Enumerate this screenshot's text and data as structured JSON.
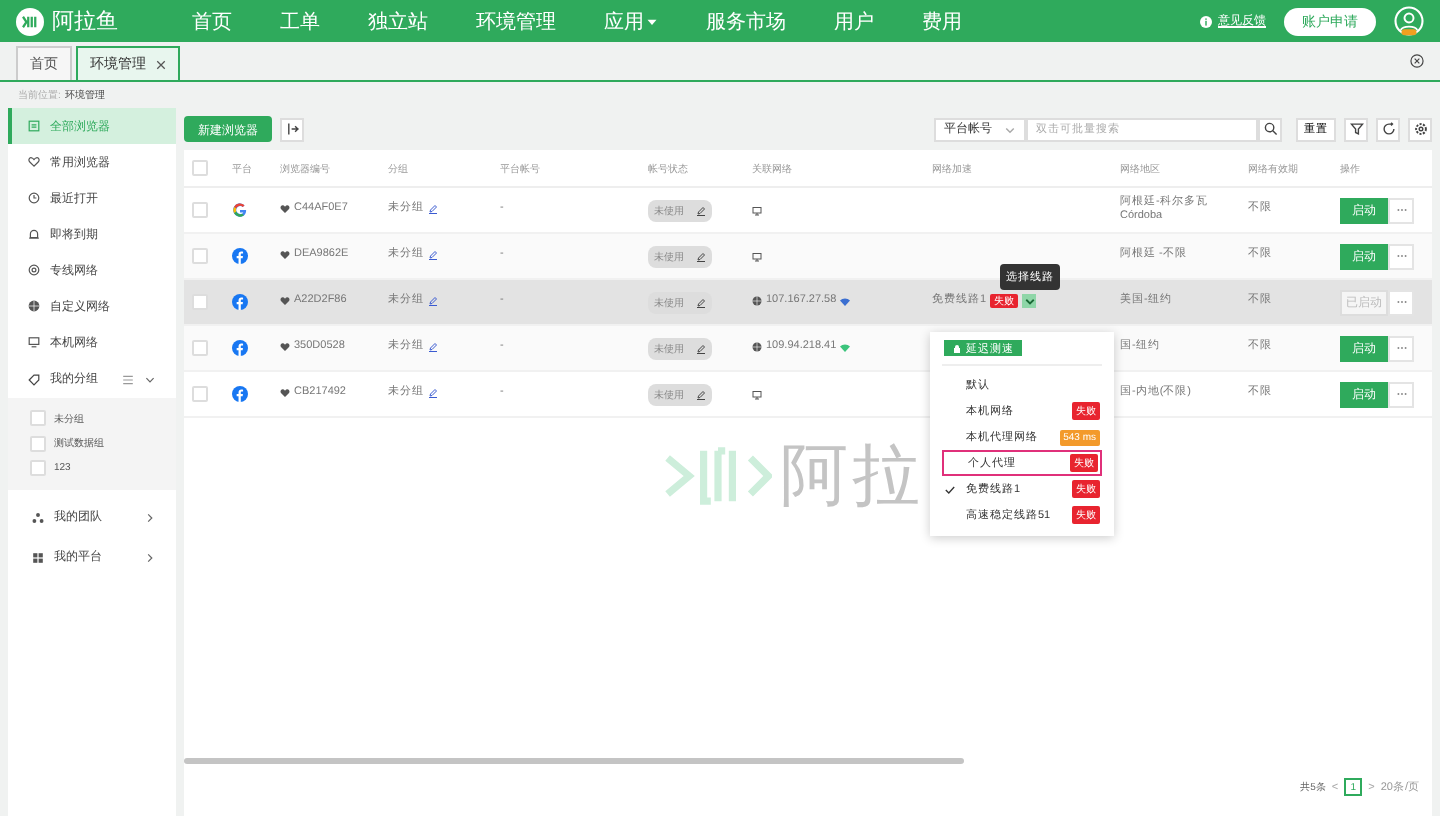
{
  "app": {
    "name": "阿拉鱼"
  },
  "nav": [
    {
      "label": "首页",
      "has_menu": false
    },
    {
      "label": "工单",
      "has_menu": false
    },
    {
      "label": "独立站",
      "has_menu": false
    },
    {
      "label": "环境管理",
      "has_menu": false
    },
    {
      "label": "应用",
      "has_menu": true
    },
    {
      "label": "服务市场",
      "has_menu": false
    },
    {
      "label": "用户",
      "has_menu": false
    },
    {
      "label": "费用",
      "has_menu": false
    }
  ],
  "header_right": {
    "feedback": "意见反馈",
    "account_button": "账户申请"
  },
  "tabs": [
    {
      "label": "首页",
      "selected": false,
      "closable": false
    },
    {
      "label": "环境管理",
      "selected": true,
      "closable": true
    }
  ],
  "breadcrumb": {
    "prefix": "当前位置:",
    "current": "环境管理"
  },
  "sidebar": {
    "items": [
      {
        "label": "全部浏览器",
        "kind": "list",
        "selected": true
      },
      {
        "label": "常用浏览器",
        "kind": "heart",
        "selected": false
      },
      {
        "label": "最近打开",
        "kind": "clock",
        "selected": false
      },
      {
        "label": "即将到期",
        "kind": "alarm",
        "selected": false
      },
      {
        "label": "专线网络",
        "kind": "target",
        "selected": false
      },
      {
        "label": "自定义网络",
        "kind": "globe",
        "selected": false
      },
      {
        "label": "本机网络",
        "kind": "monitor",
        "selected": false
      }
    ],
    "group_section": {
      "label": "我的分组",
      "expanded": true,
      "groups": [
        {
          "label": "未分组",
          "checked": false
        },
        {
          "label": "测试数据组",
          "checked": false
        },
        {
          "label": "123",
          "checked": false
        }
      ]
    },
    "bottom_items": [
      {
        "label": "我的团队",
        "kind": "team"
      },
      {
        "label": "我的平台",
        "kind": "grid"
      }
    ]
  },
  "toolbar": {
    "new_button": "新建浏览器",
    "search_scope": "平台帐号",
    "search": {
      "placeholder": "双击可批量搜索"
    },
    "reset_button": "重置"
  },
  "table": {
    "all_checked": false,
    "columns": [
      "平台",
      "浏览器编号",
      "分组",
      "平台帐号",
      "帐号状态",
      "关联网络",
      "网络加速",
      "网络地区",
      "网络有效期",
      "操作"
    ],
    "rows": [
      {
        "kind": "google",
        "checked": false,
        "id": "C44AF0E7",
        "group": "未分组",
        "account": "-",
        "status": "未使用",
        "network": {
          "kind": "local"
        },
        "region": [
          "阿根廷-科尔多瓦",
          "Córdoba"
        ],
        "expiry": "不限",
        "action": {
          "label": "启动",
          "disabled": false
        },
        "highlighted": false
      },
      {
        "kind": "facebook",
        "checked": false,
        "id": "DEA9862E",
        "group": "未分组",
        "account": "-",
        "status": "未使用",
        "network": {
          "kind": "local"
        },
        "region": [
          "阿根廷 -不限"
        ],
        "expiry": "不限",
        "action": {
          "label": "启动",
          "disabled": false
        },
        "highlighted": false
      },
      {
        "kind": "facebook",
        "checked": false,
        "id": "A22D2F86",
        "group": "未分组",
        "account": "-",
        "status": "未使用",
        "network": {
          "kind": "ip",
          "address": "107.167.27.58",
          "color": "#3b6fd1"
        },
        "accel": {
          "line": "免费线路1",
          "status": "失败"
        },
        "region": [
          "美国-纽约"
        ],
        "expiry": "不限",
        "action": {
          "label": "已启动",
          "disabled": true
        },
        "highlighted": true
      },
      {
        "kind": "facebook",
        "checked": false,
        "id": "350D0528",
        "group": "未分组",
        "account": "-",
        "status": "未使用",
        "network": {
          "kind": "ip",
          "address": "109.94.218.41",
          "color": "#3cc47c"
        },
        "region": [
          "国-纽约"
        ],
        "expiry": "不限",
        "action": {
          "label": "启动",
          "disabled": false
        },
        "highlighted": false
      },
      {
        "kind": "facebook",
        "checked": false,
        "id": "CB217492",
        "group": "未分组",
        "account": "-",
        "status": "未使用",
        "network": {
          "kind": "local"
        },
        "region": [
          "国-内地(不限)"
        ],
        "expiry": "不限",
        "action": {
          "label": "启动",
          "disabled": false
        },
        "highlighted": false
      }
    ]
  },
  "watermark_text": "阿拉",
  "tooltip": "选择线路",
  "line_menu": {
    "test_button": "延迟测速",
    "options": [
      {
        "label": "默认",
        "checked": false,
        "highlighted": false
      },
      {
        "label": "本机网络",
        "checked": false,
        "highlighted": false,
        "tag": "失败",
        "color": "#e8242f"
      },
      {
        "label": "本机代理网络",
        "checked": false,
        "highlighted": false,
        "tag": "543 ms",
        "color": "#f39a2b"
      },
      {
        "label": "个人代理",
        "checked": false,
        "highlighted": true,
        "tag": "失败",
        "color": "#e8242f"
      },
      {
        "label": "免费线路1",
        "checked": true,
        "highlighted": false,
        "tag": "失败",
        "color": "#e8242f"
      },
      {
        "label": "高速稳定线路51",
        "checked": false,
        "highlighted": false,
        "tag": "失败",
        "color": "#e8242f"
      }
    ]
  },
  "pagination": {
    "total": "共5条",
    "prev": "<",
    "page": "1",
    "next": ">",
    "page_size": "20条/页"
  }
}
